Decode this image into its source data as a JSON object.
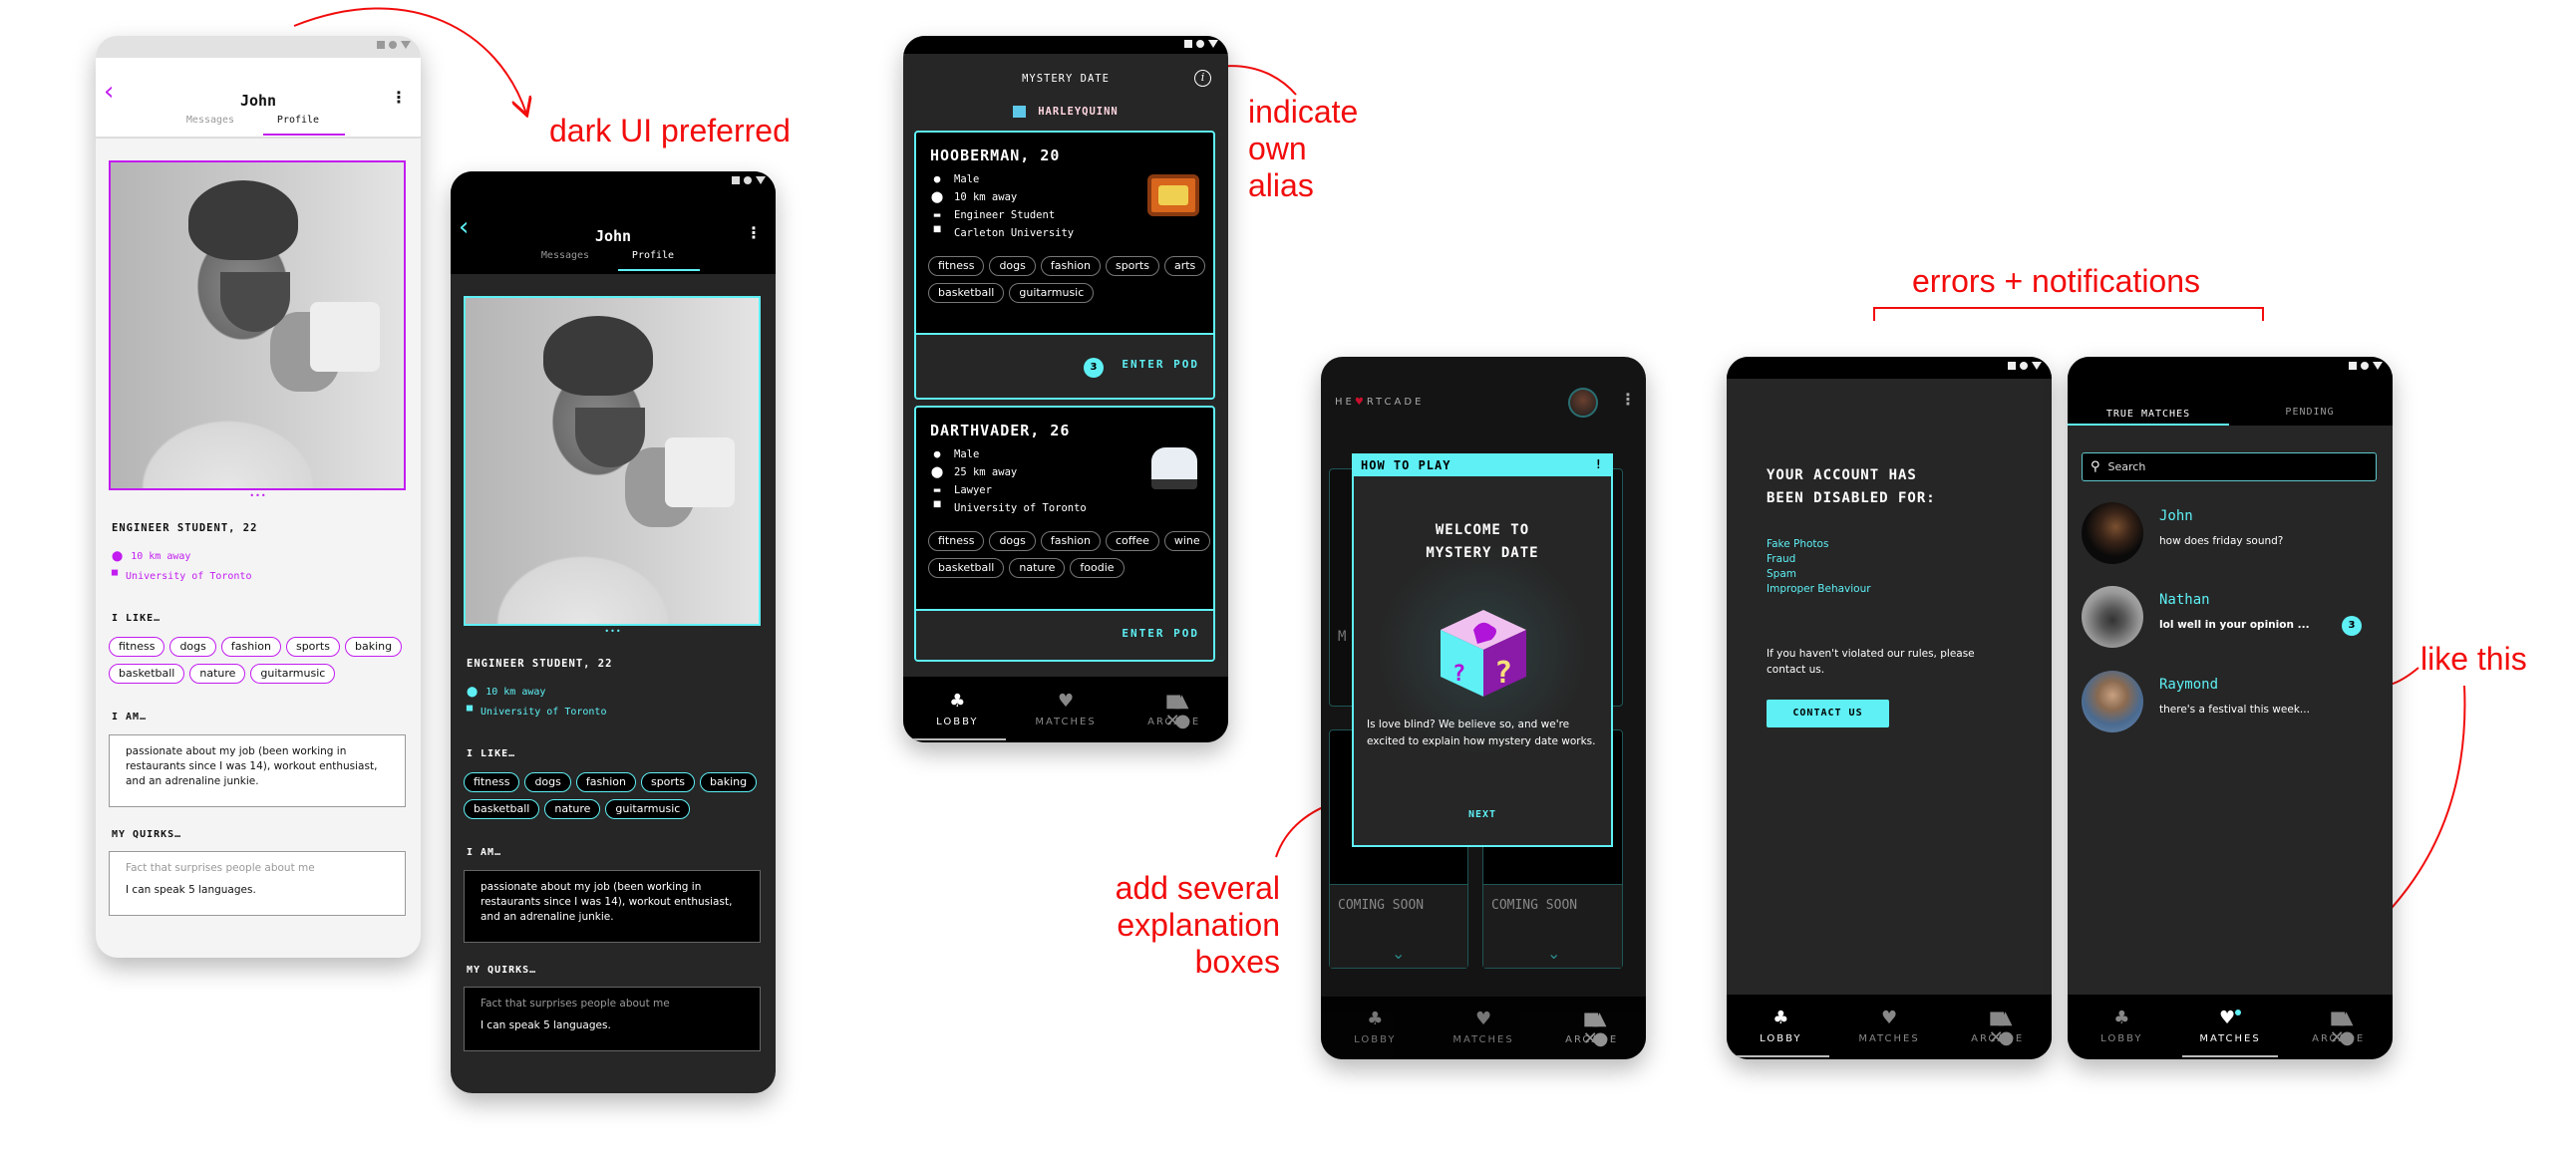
{
  "colors": {
    "accent_teal": "#5ef0f5",
    "accent_purple": "#c21cf0",
    "annotation_red": "#f20c0c",
    "dark_bg": "#262626"
  },
  "annotations": {
    "dark_ui": "dark UI preferred",
    "alias": [
      "indicate",
      "own",
      "alias"
    ],
    "explain": [
      "add several",
      "explanation",
      "boxes"
    ],
    "errors": "errors + notifications",
    "like_this": "like this"
  },
  "screens": {
    "profile_light": {
      "title": "John",
      "tab_messages": "Messages",
      "tab_profile": "Profile",
      "back_icon": "chevron-left",
      "menu_icon": "kebab",
      "headline": "ENGINEER STUDENT, 22",
      "distance": "10 km away",
      "school": "University of Toronto",
      "likes_label": "I LIKE…",
      "likes": [
        "fitness",
        "dogs",
        "fashion",
        "sports",
        "baking",
        "basketball",
        "nature",
        "guitarmusic"
      ],
      "iam_label": "I AM…",
      "iam": "passionate about my job (been working in restaurants since I was 14), workout enthusiast, and an adrenaline junkie.",
      "quirks_label": "MY QUIRKS…",
      "quirks_placeholder": "Fact that surprises people about me",
      "quirks": "I can speak 5 languages."
    },
    "profile_dark": {
      "title": "John",
      "tab_messages": "Messages",
      "tab_profile": "Profile",
      "back_icon": "chevron-left",
      "menu_icon": "kebab",
      "headline": "ENGINEER STUDENT, 22",
      "distance": "10 km away",
      "school": "University of Toronto",
      "likes_label": "I LIKE…",
      "likes": [
        "fitness",
        "dogs",
        "fashion",
        "sports",
        "baking",
        "basketball",
        "nature",
        "guitarmusic"
      ],
      "iam_label": "I AM…",
      "iam": "passionate about my job (been working in restaurants since I was 14), workout enthusiast, and an adrenaline junkie.",
      "quirks_label": "MY QUIRKS…",
      "quirks_placeholder": "Fact that surprises people about me",
      "quirks": "I can speak 5 languages."
    },
    "mystery": {
      "title": "MYSTERY DATE",
      "alias": "HARLEYQUINN",
      "cards": [
        {
          "name": "HOOBERMAN, 20",
          "gender": "Male",
          "distance": "10 km away",
          "occupation": "Engineer Student",
          "school": "Carleton University",
          "tags": [
            "fitness",
            "dogs",
            "fashion",
            "sports",
            "arts",
            "basketball",
            "guitarmusic"
          ],
          "count": "3",
          "action": "ENTER POD"
        },
        {
          "name": "DARTHVADER, 26",
          "gender": "Male",
          "distance": "25 km away",
          "occupation": "Lawyer",
          "school": "University of Toronto",
          "tags": [
            "fitness",
            "dogs",
            "fashion",
            "coffee",
            "wine",
            "basketball",
            "nature",
            "foodie"
          ],
          "action": "ENTER POD"
        }
      ]
    },
    "howto": {
      "logo_left": "HE",
      "logo_right": "RTCADE",
      "modal_title": "HOW TO PLAY",
      "modal_mark": "!",
      "heading": [
        "WELCOME TO",
        "MYSTERY DATE"
      ],
      "body": "Is love blind? We believe so, and we're excited to explain how mystery date works.",
      "next": "NEXT",
      "bg_card_label": "M",
      "coming_soon": "COMING SOON"
    },
    "disabled": {
      "heading": [
        "YOUR ACCOUNT HAS",
        "BEEN DISABLED FOR:"
      ],
      "reasons": [
        "Fake Photos",
        "Fraud",
        "Spam",
        "Improper Behaviour"
      ],
      "body": "If you haven't violated our rules, please contact us.",
      "button": "CONTACT US"
    },
    "matches": {
      "tabs": [
        "TRUE MATCHES",
        "PENDING"
      ],
      "search_placeholder": "Search",
      "items": [
        {
          "name": "John",
          "message": "how does friday sound?"
        },
        {
          "name": "Nathan",
          "message": "lol well in your opinion ...",
          "unread": "3"
        },
        {
          "name": "Raymond",
          "message": "there's a festival this week..."
        }
      ]
    }
  },
  "nav": {
    "lobby": "LOBBY",
    "matches": "MATCHES",
    "arcade": "ARCADE"
  }
}
